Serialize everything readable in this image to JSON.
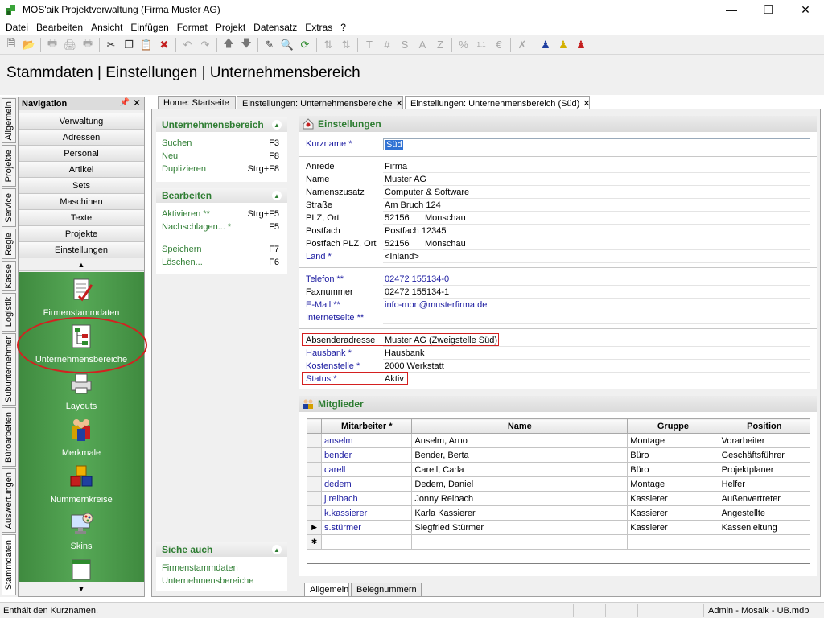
{
  "window": {
    "title": "MOS'aik Projektverwaltung (Firma Muster AG)"
  },
  "menu": [
    "Datei",
    "Bearbeiten",
    "Ansicht",
    "Einfügen",
    "Format",
    "Projekt",
    "Datensatz",
    "Extras",
    "?"
  ],
  "page_title": "Stammdaten | Einstellungen | Unternehmensbereich",
  "vertical_tabs": [
    "Allgemein",
    "Projekte",
    "Service",
    "Regie",
    "Kasse",
    "Logistik",
    "Subunternehmer",
    "Büroarbeiten",
    "Auswertungen",
    "Stammdaten"
  ],
  "navigation": {
    "title": "Navigation",
    "items": [
      "Verwaltung",
      "Adressen",
      "Personal",
      "Artikel",
      "Sets",
      "Maschinen",
      "Texte",
      "Projekte",
      "Einstellungen"
    ],
    "icons": [
      "Firmenstammdaten",
      "Unternehmensbereiche",
      "Layouts",
      "Merkmale",
      "Nummernkreise",
      "Skins"
    ]
  },
  "doc_tabs": [
    "Home: Startseite",
    "Einstellungen: Unternehmensbereiche",
    "Einstellungen: Unternehmensbereich (Süd)"
  ],
  "task_panels": {
    "unternehmensbereich": {
      "title": "Unternehmensbereich",
      "rows": [
        {
          "label": "Suchen",
          "key": "F3"
        },
        {
          "label": "Neu",
          "key": "F8"
        },
        {
          "label": "Duplizieren",
          "key": "Strg+F8"
        }
      ]
    },
    "bearbeiten": {
      "title": "Bearbeiten",
      "rows": [
        {
          "label": "Aktivieren **",
          "key": "Strg+F5"
        },
        {
          "label": "Nachschlagen... *",
          "key": "F5"
        },
        {
          "label": "Speichern",
          "key": "F7"
        },
        {
          "label": "Löschen...",
          "key": "F6"
        }
      ]
    },
    "siehe_auch": {
      "title": "Siehe auch",
      "links": [
        "Firmenstammdaten",
        "Unternehmensbereiche"
      ]
    }
  },
  "settings": {
    "title": "Einstellungen",
    "kurzname": {
      "label": "Kurzname *",
      "value": "Süd"
    },
    "address": [
      {
        "label": "Anrede",
        "value": "Firma"
      },
      {
        "label": "Name",
        "value": "Muster AG"
      },
      {
        "label": "Namenszusatz",
        "value": "Computer & Software"
      },
      {
        "label": "Straße",
        "value": "Am Bruch 124"
      },
      {
        "label": "PLZ, Ort",
        "value": "52156",
        "value2": "Monschau"
      },
      {
        "label": "Postfach",
        "value": "Postfach 12345"
      },
      {
        "label": "Postfach PLZ, Ort",
        "value": "52156",
        "value2": "Monschau"
      },
      {
        "label": "Land *",
        "value": "<Inland>"
      }
    ],
    "contact": [
      {
        "label": "Telefon **",
        "value": "02472 155134-0"
      },
      {
        "label": "Faxnummer",
        "value": "02472 155134-1"
      },
      {
        "label": "E-Mail **",
        "value": "info-mon@musterfirma.de"
      },
      {
        "label": "Internetseite **",
        "value": ""
      }
    ],
    "other": [
      {
        "label": "Absenderadresse",
        "value": "Muster AG (Zweigstelle Süd)"
      },
      {
        "label": "Hausbank *",
        "value": "Hausbank"
      },
      {
        "label": "Kostenstelle *",
        "value": "2000 Werkstatt"
      },
      {
        "label": "Status *",
        "value": "Aktiv"
      }
    ]
  },
  "members": {
    "title": "Mitglieder",
    "columns": [
      "Mitarbeiter *",
      "Name",
      "Gruppe",
      "Position"
    ],
    "rows": [
      [
        "anselm",
        "Anselm, Arno",
        "Montage",
        "Vorarbeiter"
      ],
      [
        "bender",
        "Bender, Berta",
        "Büro",
        "Geschäftsführer"
      ],
      [
        "carell",
        "Carell, Carla",
        "Büro",
        "Projektplaner"
      ],
      [
        "dedem",
        "Dedem, Daniel",
        "Montage",
        "Helfer"
      ],
      [
        "j.reibach",
        "Jonny Reibach",
        "Kassierer",
        "Außenvertreter"
      ],
      [
        "k.kassierer",
        "Karla Kassierer",
        "Kassierer",
        "Angestellte"
      ],
      [
        "s.stürmer",
        "Siegfried Stürmer",
        "Kassierer",
        "Kassenleitung"
      ]
    ]
  },
  "bottom_tabs": [
    "Allgemein",
    "Belegnummern"
  ],
  "status": {
    "message": "Enthält den Kurznamen.",
    "right": "Admin - Mosaik - UB.mdb"
  }
}
